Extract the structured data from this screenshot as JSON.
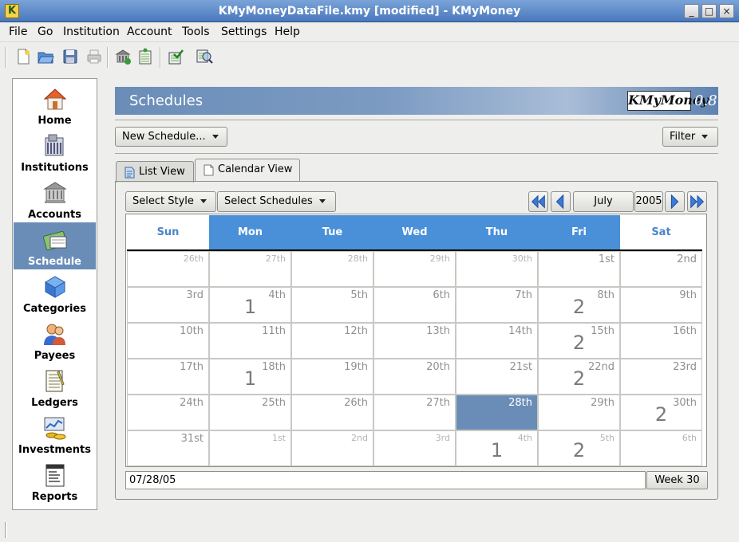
{
  "window": {
    "title": "KMyMoneyDataFile.kmy [modified] - KMyMoney",
    "controls": [
      "_",
      "□",
      "×"
    ]
  },
  "menu": [
    "File",
    "Go",
    "Institution",
    "Account",
    "Tools",
    "Settings",
    "Help"
  ],
  "toolbar": {
    "icons": [
      "new-file-icon",
      "open-folder-icon",
      "save-icon",
      "print-icon",
      "new-institution-icon",
      "new-account-icon",
      "reconcile-icon",
      "find-transaction-icon"
    ]
  },
  "sidebar": {
    "items": [
      {
        "label": "Home",
        "icon": "home-icon"
      },
      {
        "label": "Institutions",
        "icon": "institutions-icon"
      },
      {
        "label": "Accounts",
        "icon": "accounts-icon"
      },
      {
        "label": "Schedule",
        "icon": "schedule-icon",
        "active": true
      },
      {
        "label": "Categories",
        "icon": "categories-icon"
      },
      {
        "label": "Payees",
        "icon": "payees-icon"
      },
      {
        "label": "Ledgers",
        "icon": "ledgers-icon"
      },
      {
        "label": "Investments",
        "icon": "investments-icon"
      },
      {
        "label": "Reports",
        "icon": "reports-icon"
      }
    ]
  },
  "header": {
    "title": "Schedules",
    "logo_text": "KMyMoney",
    "logo_version": "0.8"
  },
  "actions": {
    "new_schedule": "New Schedule...",
    "filter": "Filter"
  },
  "tabs": [
    {
      "label": "List View",
      "active": false
    },
    {
      "label": "Calendar View",
      "active": true
    }
  ],
  "calendar": {
    "select_style": "Select Style",
    "select_schedules": "Select Schedules",
    "month": "July",
    "year": "2005",
    "days": [
      "Sun",
      "Mon",
      "Tue",
      "Wed",
      "Thu",
      "Fri",
      "Sat"
    ],
    "weekend_days": [
      "Sun",
      "Sat"
    ],
    "weeks": [
      [
        {
          "d": "26th",
          "o": true
        },
        {
          "d": "27th",
          "o": true
        },
        {
          "d": "28th",
          "o": true
        },
        {
          "d": "29th",
          "o": true
        },
        {
          "d": "30th",
          "o": true
        },
        {
          "d": "1st"
        },
        {
          "d": "2nd"
        }
      ],
      [
        {
          "d": "3rd"
        },
        {
          "d": "4th",
          "c": "1"
        },
        {
          "d": "5th"
        },
        {
          "d": "6th"
        },
        {
          "d": "7th"
        },
        {
          "d": "8th",
          "c": "2"
        },
        {
          "d": "9th"
        }
      ],
      [
        {
          "d": "10th"
        },
        {
          "d": "11th"
        },
        {
          "d": "12th"
        },
        {
          "d": "13th"
        },
        {
          "d": "14th"
        },
        {
          "d": "15th",
          "c": "2"
        },
        {
          "d": "16th"
        }
      ],
      [
        {
          "d": "17th"
        },
        {
          "d": "18th",
          "c": "1"
        },
        {
          "d": "19th"
        },
        {
          "d": "20th"
        },
        {
          "d": "21st"
        },
        {
          "d": "22nd",
          "c": "2"
        },
        {
          "d": "23rd"
        }
      ],
      [
        {
          "d": "24th"
        },
        {
          "d": "25th"
        },
        {
          "d": "26th"
        },
        {
          "d": "27th"
        },
        {
          "d": "28th",
          "selected": true
        },
        {
          "d": "29th"
        },
        {
          "d": "30th",
          "c": "2"
        }
      ],
      [
        {
          "d": "31st"
        },
        {
          "d": "1st",
          "o": true
        },
        {
          "d": "2nd",
          "o": true
        },
        {
          "d": "3rd",
          "o": true
        },
        {
          "d": "4th",
          "o": true,
          "c": "1"
        },
        {
          "d": "5th",
          "o": true,
          "c": "2"
        },
        {
          "d": "6th",
          "o": true
        }
      ]
    ],
    "selected_date": "07/28/05",
    "week_label": "Week 30"
  },
  "colors": {
    "accent": "#6a8db8",
    "weekday_header": "#4a90d9",
    "weekend_text": "#4a86c8"
  }
}
